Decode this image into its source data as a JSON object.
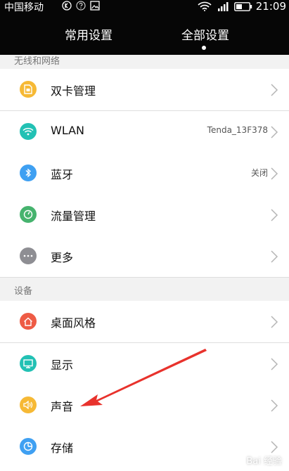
{
  "status_bar": {
    "carrier": "中国移动",
    "time": "21:09"
  },
  "tabs": [
    {
      "label": "常用设置"
    },
    {
      "label": "全部设置"
    }
  ],
  "sections": {
    "wireless": {
      "header": "无线和网络"
    },
    "device": {
      "header": "设备"
    }
  },
  "rows": {
    "dual_sim": {
      "label": "双卡管理"
    },
    "wlan": {
      "label": "WLAN",
      "value": "Tenda_13F378"
    },
    "bluetooth": {
      "label": "蓝牙",
      "value": "关闭"
    },
    "data_usage": {
      "label": "流量管理"
    },
    "more": {
      "label": "更多"
    },
    "desktop_style": {
      "label": "桌面风格"
    },
    "display": {
      "label": "显示"
    },
    "sound": {
      "label": "声音"
    },
    "storage": {
      "label": "存储"
    }
  },
  "colors": {
    "yellow": "#f6b935",
    "teal": "#22c1b4",
    "blue": "#3fa0f2",
    "green": "#46b36e",
    "gray": "#8e8e93",
    "red": "#ee5b45",
    "annotation_red": "#e8322c"
  },
  "watermark": "Bai 经验"
}
